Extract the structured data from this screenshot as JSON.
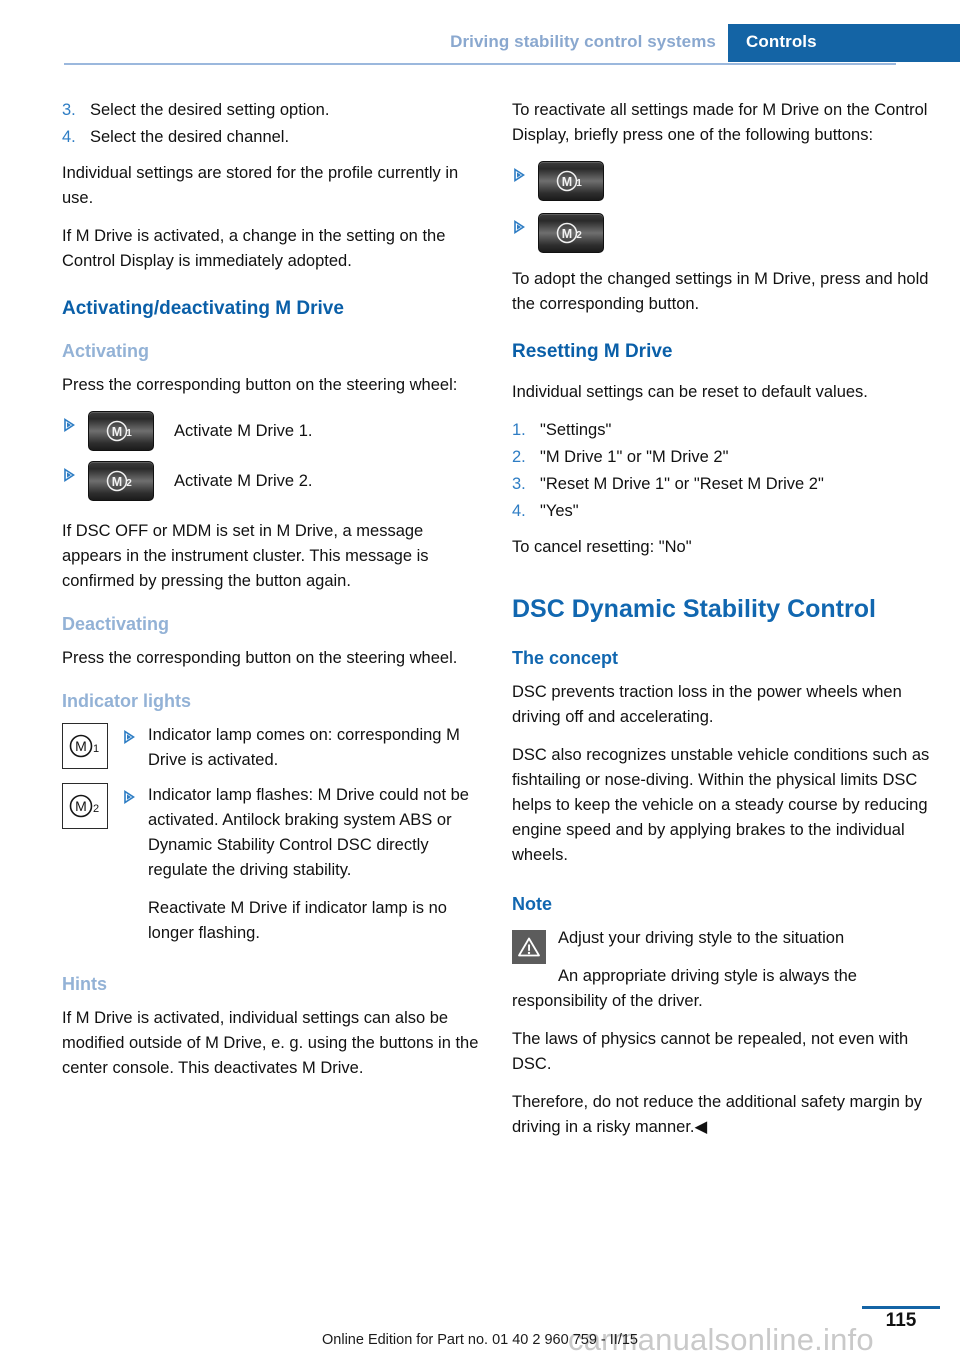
{
  "header": {
    "chapter": "Driving stability control systems",
    "section": "Controls"
  },
  "left_column": {
    "steps": [
      {
        "num": "3.",
        "text": "Select the desired setting option."
      },
      {
        "num": "4.",
        "text": "Select the desired channel."
      }
    ],
    "para_profile": "Individual settings are stored for the profile currently in use.",
    "para_adopted": "If M Drive is activated, a change in the setting on the Control Display is immediately adopted.",
    "heading_activating_deactivating": "Activating/deactivating M Drive",
    "heading_activating": "Activating",
    "para_press_steering": "Press the corresponding button on the steering wheel:",
    "button_items": [
      {
        "icon": "m-drive-1-button-icon",
        "digit": "1",
        "label": "Activate M Drive 1."
      },
      {
        "icon": "m-drive-2-button-icon",
        "digit": "2",
        "label": "Activate M Drive 2."
      }
    ],
    "para_dsc_off": "If DSC OFF or MDM is set in M Drive, a message appears in the instrument cluster. This message is confirmed by pressing the button again.",
    "heading_deactivating": "Deactivating",
    "para_press_steering_2": "Press the corresponding button on the steering wheel.",
    "heading_indicator_lights": "Indicator lights",
    "indicator_items": [
      {
        "icon": "m-drive-1-lamp-icon",
        "digit": "1",
        "text": "Indicator lamp comes on: corresponding M Drive is activated.",
        "extra": ""
      },
      {
        "icon": "m-drive-2-lamp-icon",
        "digit": "2",
        "text": "Indicator lamp flashes: M Drive could not be activated. Antilock braking system ABS or Dynamic Stability Control DSC directly regulate the driving stability.",
        "extra": "Reactivate M Drive if indicator lamp is no longer flashing."
      }
    ],
    "heading_hints": "Hints",
    "para_hints": "If M Drive is activated, individual settings can also be modified outside of M Drive, e. g. using the buttons in the center console. This deactivates M Drive."
  },
  "right_column": {
    "para_reactivate": "To reactivate all settings made for M Drive on the Control Display, briefly press one of the following buttons:",
    "button_items": [
      {
        "icon": "m-drive-1-button-icon",
        "digit": "1"
      },
      {
        "icon": "m-drive-2-button-icon",
        "digit": "2"
      }
    ],
    "para_adopt": "To adopt the changed settings in M Drive, press and hold the corresponding button.",
    "heading_resetting": "Resetting M Drive",
    "para_reset_default": "Individual settings can be reset to default values.",
    "reset_steps": [
      {
        "num": "1.",
        "text": "\"Settings\""
      },
      {
        "num": "2.",
        "text": "\"M Drive 1\" or \"M Drive 2\""
      },
      {
        "num": "3.",
        "text": "\"Reset M Drive 1\" or \"Reset M Drive 2\""
      },
      {
        "num": "4.",
        "text": "\"Yes\""
      }
    ],
    "para_cancel": "To cancel resetting: \"No\"",
    "heading_dsc": "DSC Dynamic Stability Control",
    "heading_concept": "The concept",
    "para_concept_1": "DSC prevents traction loss in the power wheels when driving off and accelerating.",
    "para_concept_2": "DSC also recognizes unstable vehicle conditions such as fishtailing or nose-diving. Within the physical limits DSC helps to keep the vehicle on a steady course by reducing engine speed and by applying brakes to the individual wheels.",
    "heading_note": "Note",
    "note_title": "Adjust your driving style to the situation",
    "note_para_1": "An appropriate driving style is always the responsibility of the driver.",
    "note_para_2": "The laws of physics cannot be repealed, not even with DSC.",
    "note_para_3": "Therefore, do not reduce the additional safety margin by driving in a risky manner.◀"
  },
  "footer": {
    "edition": "Online Edition for Part no. 01 40 2 960 759 - II/15",
    "page_number": "115",
    "watermark": "carmanualsonline.info"
  },
  "colors": {
    "banner_blue": "#1464a5",
    "heading_blue": "#1167b0",
    "sub_heading_blue": "#93b2d6",
    "rule_blue": "#9bb8dd",
    "number_blue": "#2e7dc4",
    "warning_gray": "#5c5c5c"
  }
}
